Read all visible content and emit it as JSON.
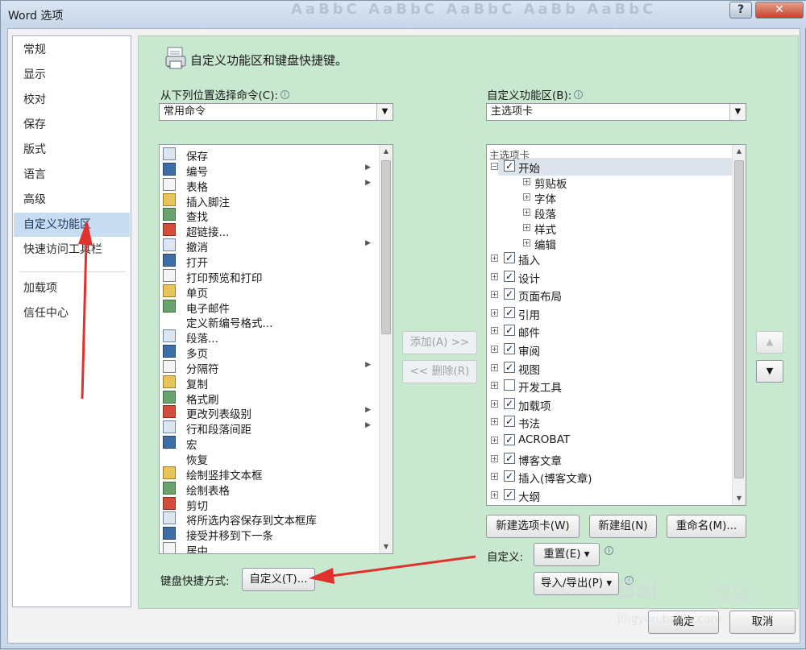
{
  "window": {
    "title": "Word 选项",
    "help_label": "?",
    "close_label": "✕",
    "bg_ribbon_text": "AaBbC AaBbC AaBbC AaBb AaBbC"
  },
  "nav": {
    "items": [
      {
        "label": "常规"
      },
      {
        "label": "显示"
      },
      {
        "label": "校对"
      },
      {
        "label": "保存"
      },
      {
        "label": "版式"
      },
      {
        "label": "语言"
      },
      {
        "label": "高级"
      },
      {
        "label": "自定义功能区",
        "selected": true
      },
      {
        "label": "快速访问工具栏"
      },
      {
        "label": "加载项"
      },
      {
        "label": "信任中心"
      }
    ]
  },
  "header": {
    "title": "自定义功能区和键盘快捷键。"
  },
  "left": {
    "label": "从下列位置选择命令(C):",
    "combo_value": "常用命令",
    "commands": [
      {
        "label": "保存",
        "icon": "save-icon",
        "sub": false
      },
      {
        "label": "编号",
        "icon": "numbering-icon",
        "sub": true
      },
      {
        "label": "表格",
        "icon": "table-icon",
        "sub": true
      },
      {
        "label": "插入脚注",
        "icon": "footnote-icon",
        "sub": false
      },
      {
        "label": "查找",
        "icon": "find-icon",
        "sub": false
      },
      {
        "label": "超链接...",
        "icon": "hyperlink-icon",
        "sub": false
      },
      {
        "label": "撤消",
        "icon": "undo-icon",
        "sub": true
      },
      {
        "label": "打开",
        "icon": "open-folder-icon",
        "sub": false
      },
      {
        "label": "打印预览和打印",
        "icon": "print-preview-icon",
        "sub": false
      },
      {
        "label": "单页",
        "icon": "single-page-icon",
        "sub": false
      },
      {
        "label": "电子邮件",
        "icon": "email-icon",
        "sub": false
      },
      {
        "label": "定义新编号格式...",
        "icon": "",
        "sub": false
      },
      {
        "label": "段落...",
        "icon": "paragraph-icon",
        "sub": false
      },
      {
        "label": "多页",
        "icon": "multiple-pages-icon",
        "sub": false
      },
      {
        "label": "分隔符",
        "icon": "break-icon",
        "sub": true
      },
      {
        "label": "复制",
        "icon": "copy-icon",
        "sub": false
      },
      {
        "label": "格式刷",
        "icon": "format-painter-icon",
        "sub": false
      },
      {
        "label": "更改列表级别",
        "icon": "list-level-icon",
        "sub": true
      },
      {
        "label": "行和段落间距",
        "icon": "line-spacing-icon",
        "sub": true
      },
      {
        "label": "宏",
        "icon": "macro-icon",
        "sub": false
      },
      {
        "label": "恢复",
        "icon": "",
        "sub": false
      },
      {
        "label": "绘制竖排文本框",
        "icon": "vertical-textbox-icon",
        "sub": false
      },
      {
        "label": "绘制表格",
        "icon": "draw-table-icon",
        "sub": false
      },
      {
        "label": "剪切",
        "icon": "cut-icon",
        "sub": false
      },
      {
        "label": "将所选内容保存到文本框库",
        "icon": "save-textbox-icon",
        "sub": false
      },
      {
        "label": "接受并移到下一条",
        "icon": "accept-icon",
        "sub": false
      },
      {
        "label": "居中",
        "icon": "center-icon",
        "sub": false
      }
    ]
  },
  "middle": {
    "add_label": "添加(A) >>",
    "remove_label": "<< 删除(R)"
  },
  "right": {
    "label": "自定义功能区(B):",
    "combo_value": "主选项卡",
    "tree_header": "主选项卡",
    "tree": [
      {
        "label": "开始",
        "level": 0,
        "expander": "⊟",
        "checked": true,
        "highlight": true
      },
      {
        "label": "剪贴板",
        "level": 1,
        "expander": "⊞",
        "checked": null
      },
      {
        "label": "字体",
        "level": 1,
        "expander": "⊞",
        "checked": null
      },
      {
        "label": "段落",
        "level": 1,
        "expander": "⊞",
        "checked": null
      },
      {
        "label": "样式",
        "level": 1,
        "expander": "⊞",
        "checked": null
      },
      {
        "label": "编辑",
        "level": 1,
        "expander": "⊞",
        "checked": null
      },
      {
        "label": "插入",
        "level": 0,
        "expander": "⊞",
        "checked": true
      },
      {
        "label": "设计",
        "level": 0,
        "expander": "⊞",
        "checked": true
      },
      {
        "label": "页面布局",
        "level": 0,
        "expander": "⊞",
        "checked": true
      },
      {
        "label": "引用",
        "level": 0,
        "expander": "⊞",
        "checked": true
      },
      {
        "label": "邮件",
        "level": 0,
        "expander": "⊞",
        "checked": true
      },
      {
        "label": "审阅",
        "level": 0,
        "expander": "⊞",
        "checked": true
      },
      {
        "label": "视图",
        "level": 0,
        "expander": "⊞",
        "checked": true
      },
      {
        "label": "开发工具",
        "level": 0,
        "expander": "⊞",
        "checked": false
      },
      {
        "label": "加载项",
        "level": 0,
        "expander": "⊞",
        "checked": true
      },
      {
        "label": "书法",
        "level": 0,
        "expander": "⊞",
        "checked": true
      },
      {
        "label": "ACROBAT",
        "level": 0,
        "expander": "⊞",
        "checked": true
      },
      {
        "label": "博客文章",
        "level": 0,
        "expander": "⊞",
        "checked": true
      },
      {
        "label": "插入(博客文章)",
        "level": 0,
        "expander": "⊞",
        "checked": true
      },
      {
        "label": "大纲",
        "level": 0,
        "expander": "⊞",
        "checked": true
      }
    ],
    "new_tab_label": "新建选项卡(W)",
    "new_group_label": "新建组(N)",
    "rename_label": "重命名(M)...",
    "customize_label": "自定义:",
    "reset_label": "重置(E) ▾",
    "import_export_label": "导入/导出(P) ▾",
    "move_up_label": "▲",
    "move_down_label": "▼"
  },
  "keyboard": {
    "label": "键盘快捷方式:",
    "button_label": "自定义(T)..."
  },
  "footer": {
    "ok_label": "确定",
    "cancel_label": "取消"
  },
  "watermark": {
    "logo": "Bai ",
    "text": "经验",
    "url": "jingyan.baidu.com"
  },
  "colors": {
    "panel_green": "#c8e8cf",
    "selected_nav": "#c8dcf2",
    "annotation_red": "#e0312c"
  }
}
